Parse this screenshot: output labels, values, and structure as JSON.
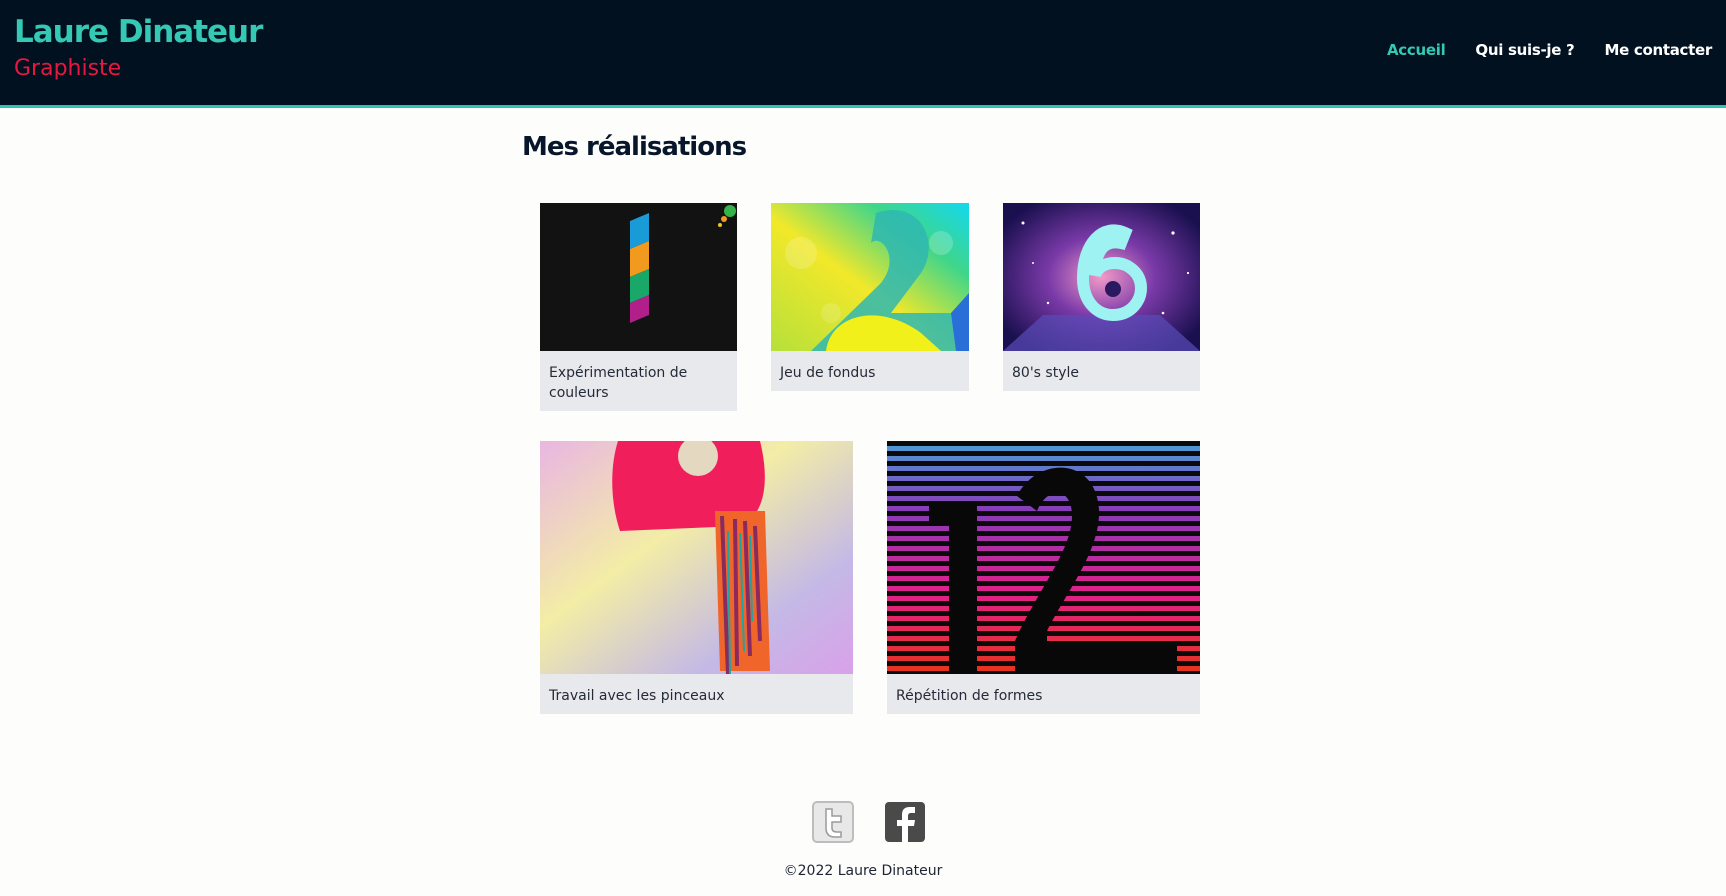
{
  "header": {
    "title": "Laure Dinateur",
    "subtitle": "Graphiste",
    "nav": [
      {
        "label": "Accueil",
        "active": true
      },
      {
        "label": "Qui suis-je ?",
        "active": false
      },
      {
        "label": "Me contacter",
        "active": false
      }
    ]
  },
  "main": {
    "section_title": "Mes réalisations",
    "works": [
      {
        "caption": "Expérimentation de couleurs",
        "art": "number-1-colored-stripes"
      },
      {
        "caption": "Jeu de fondus",
        "art": "number-2-gradient-blend"
      },
      {
        "caption": "80's style",
        "art": "number-6-retro-neon"
      },
      {
        "caption": "Travail avec les pinceaux",
        "art": "number-9-brush-paint"
      },
      {
        "caption": "Répétition de formes",
        "art": "number-12-striped-lines"
      }
    ]
  },
  "footer": {
    "socials": [
      {
        "name": "twitter-icon"
      },
      {
        "name": "facebook-icon"
      }
    ],
    "copyright": "©2022 Laure Dinateur"
  },
  "colors": {
    "header_bg": "#02111f",
    "accent_teal": "#35c8b4",
    "accent_red": "#e8173f",
    "card_bg": "#e8e9ec"
  }
}
